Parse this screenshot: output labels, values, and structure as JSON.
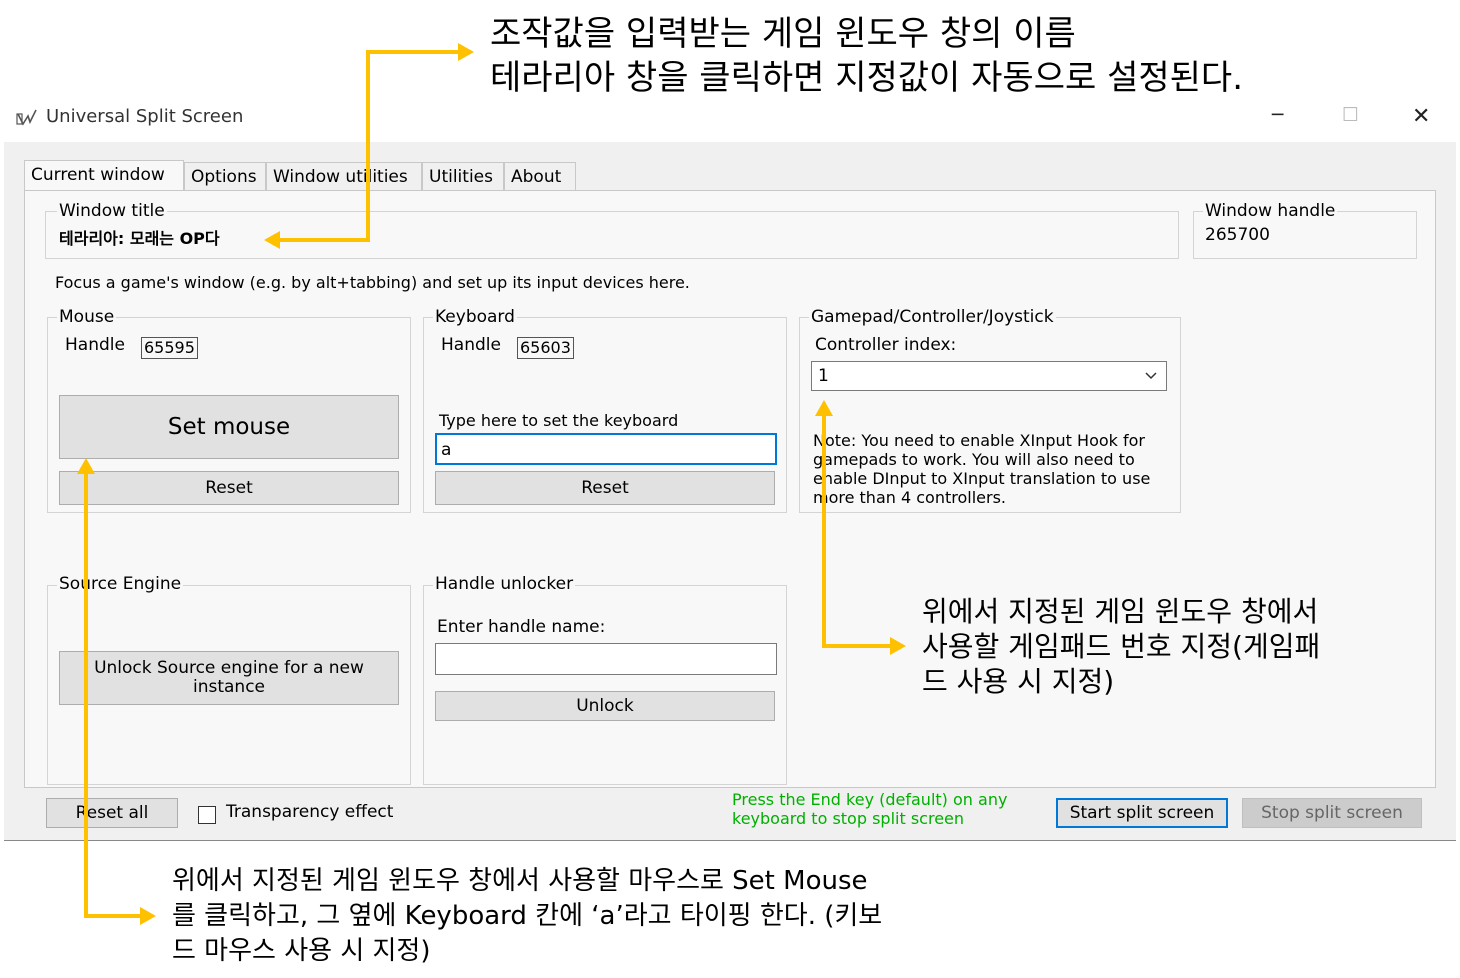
{
  "annotations": {
    "top_line1": "조작값을 입력받는 게임 윈도우 창의 이름",
    "top_line2": "테라리아 창을 클릭하면 지정값이 자동으로 설정된다.",
    "right_line1": "위에서 지정된 게임 윈도우 창에서",
    "right_line2": "사용할 게임패드 번호 지정(게임패",
    "right_line3": "드 사용 시 지정)",
    "bottom_line1": "위에서 지정된 게임 윈도우 창에서 사용할 마우스로 Set Mouse",
    "bottom_line2": "를 클릭하고, 그 옆에 Keyboard 칸에 ‘a’라고 타이핑 한다. (키보",
    "bottom_line3": "드 마우스 사용 시 지정)",
    "arrow_color": "#ffc000"
  },
  "window": {
    "title": "Universal Split Screen",
    "minimize": "─",
    "maximize": "☐",
    "close": "✕",
    "tabs": [
      "Current window",
      "Options",
      "Window utilities",
      "Utilities",
      "About"
    ],
    "active_tab": "Current window"
  },
  "current_window": {
    "window_title_label": "Window title",
    "window_title_value": "테라리아: 모래는 OP다",
    "window_handle_label": "Window handle",
    "window_handle_value": "265700",
    "instructions": "Focus a game's window (e.g. by alt+tabbing) and set up its input devices here."
  },
  "mouse": {
    "group_label": "Mouse",
    "handle_label": "Handle",
    "handle_value": "65595",
    "set_button": "Set mouse",
    "reset_button": "Reset"
  },
  "keyboard": {
    "group_label": "Keyboard",
    "handle_label": "Handle",
    "handle_value": "65603",
    "type_hint": "Type here to set the keyboard",
    "input_value": "a",
    "reset_button": "Reset"
  },
  "gamepad": {
    "group_label": "Gamepad/Controller/Joystick",
    "index_label": "Controller index:",
    "index_value": "1",
    "note_line1": "Note: You need to enable XInput Hook for",
    "note_line2": "gamepads to work. You will also need to",
    "note_line3": "enable DInput to XInput translation to use",
    "note_line4": "more than 4 controllers."
  },
  "source_engine": {
    "group_label": "Source Engine",
    "button_line1": "Unlock Source engine for a new",
    "button_line2": "instance"
  },
  "handle_unlocker": {
    "group_label": "Handle unlocker",
    "enter_label": "Enter handle name:",
    "input_value": "",
    "unlock_button": "Unlock"
  },
  "footer": {
    "reset_all": "Reset all",
    "transparency_label": "Transparency effect",
    "transparency_checked": false,
    "press_hint_line1": "Press the End key (default) on any",
    "press_hint_line2": "keyboard to stop split screen",
    "press_hint_color": "#00b000",
    "start_button": "Start split screen",
    "stop_button": "Stop split screen"
  }
}
